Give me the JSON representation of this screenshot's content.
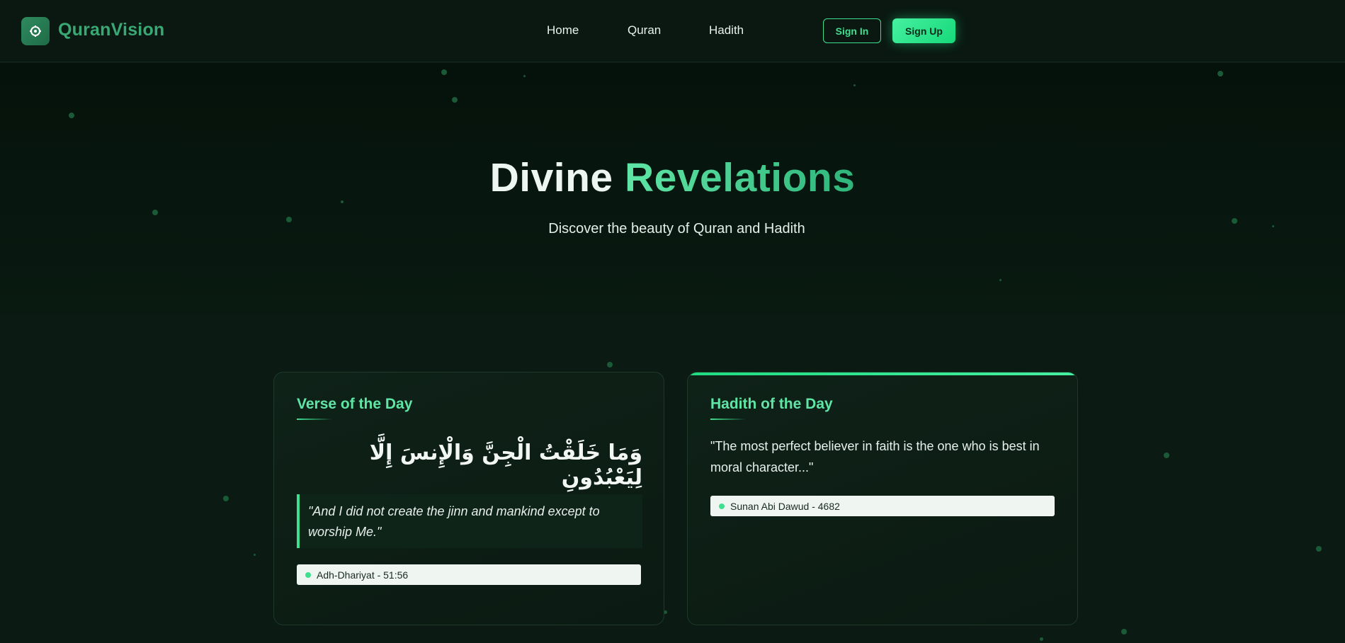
{
  "nav": {
    "logo_text": "QuranVision",
    "links": [
      "Home",
      "Quran",
      "Hadith"
    ],
    "sign_in": "Sign In",
    "sign_up": "Sign Up"
  },
  "hero": {
    "title_part1": "Divine",
    "title_part2": "Revelations",
    "subtitle": "Discover the beauty of Quran and Hadith"
  },
  "verse": {
    "title": "Verse of the Day",
    "arabic": "وَمَا خَلَقْتُ الْجِنَّ وَالْإِنسَ إِلَّا لِيَعْبُدُونِ",
    "translation": "\"And I did not create the jinn and mankind except to worship Me.\"",
    "source": "Adh-Dhariyat - 51:56"
  },
  "hadith": {
    "title": "Hadith of the Day",
    "text": "\"The most perfect believer in faith is the one who is best in moral character...\"",
    "source": "Sunan Abi Dawud - 4682"
  },
  "colors": {
    "accent": "#3ee08f",
    "accent_light": "#5fe6a6",
    "brand": "#3aa874",
    "background": "#0b1a12"
  }
}
